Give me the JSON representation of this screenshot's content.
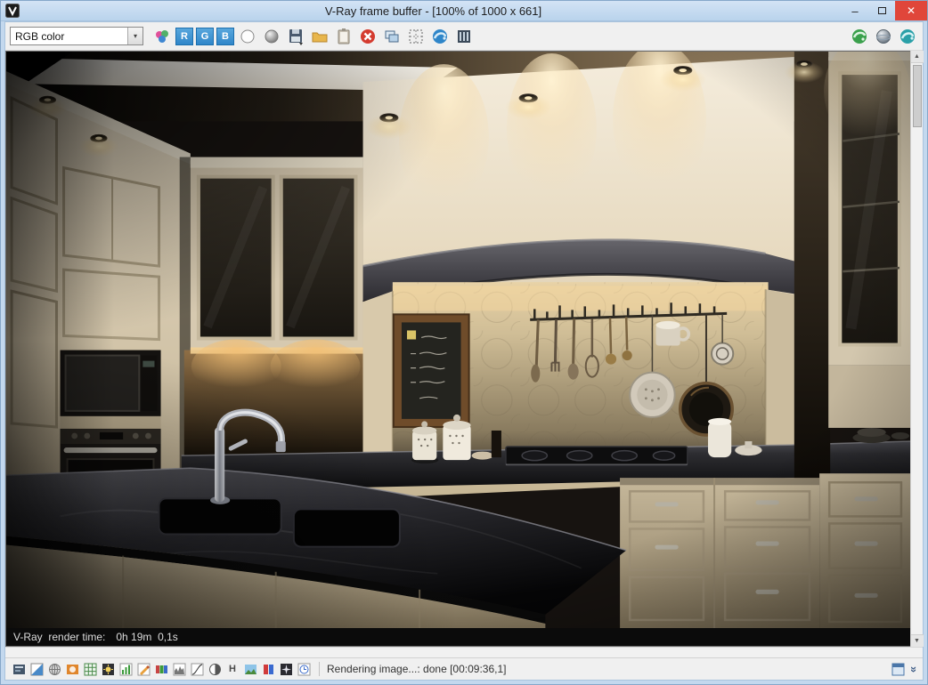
{
  "window": {
    "title": "V-Ray frame buffer - [100% of 1000 x 661]",
    "controls": {
      "minimize_glyph": "–",
      "close_glyph": "✕"
    }
  },
  "toolbar": {
    "channel_select": {
      "value": "RGB color"
    },
    "red_channel": "R",
    "green_channel": "G",
    "blue_channel": "B"
  },
  "render_bar": {
    "label": "V-Ray  render time:",
    "value": "0h 19m  0,1s"
  },
  "statusbar": {
    "message": "Rendering image...: done [00:09:36,1]",
    "clamp_glyph": "H"
  },
  "icons": {
    "dropdown_arrow": "▾",
    "scroll_up": "▲",
    "scroll_down": "▼",
    "collapse_chevrons": "»"
  },
  "colors": {
    "titlebar": "#c3d8ee",
    "close_button": "#e0463a",
    "toolbar_bg": "#f0f0f0",
    "channel_button_blue": "#3b97d3",
    "timebar_bg": "#0b0b0b"
  }
}
